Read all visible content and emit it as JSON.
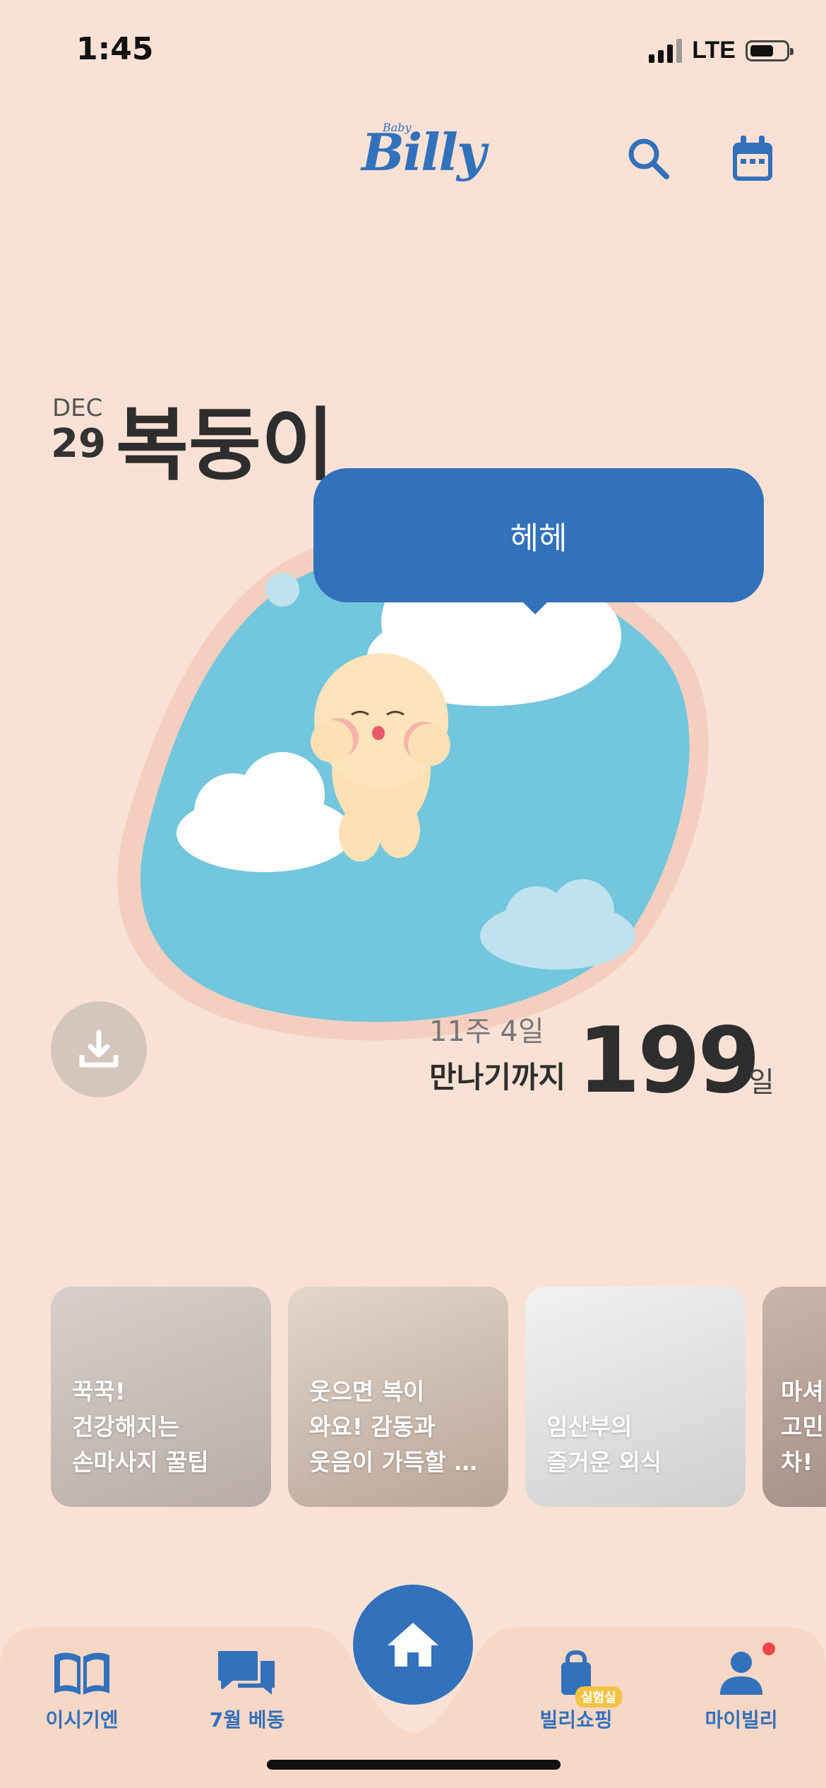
{
  "status_bar": {
    "time": "1:45",
    "network": "LTE"
  },
  "header": {
    "logo_small": "Baby",
    "logo_text": "Billy",
    "search_icon": "search-icon",
    "calendar_icon": "calendar-icon"
  },
  "profile": {
    "month": "DEC",
    "day": "29",
    "name": "복둥이"
  },
  "speech_bubble": {
    "text": "헤헤"
  },
  "countdown": {
    "weeks_days": "11주 4일",
    "until_label": "만나기까지",
    "days": "199",
    "unit": "일"
  },
  "cards": [
    {
      "text": "꾹꾹!\n건강해지는\n손마사지 꿀팁"
    },
    {
      "text": "웃으면 복이\n와요! 감동과\n웃음이 가득할 …"
    },
    {
      "text": "임산부의\n즐거운 외식"
    },
    {
      "text": "마셔\n고민\n차!"
    }
  ],
  "tabbar": {
    "items": [
      {
        "label": "이시기엔",
        "icon": "book-icon"
      },
      {
        "label": "7월 베동",
        "icon": "chat-icon"
      },
      {
        "label": "",
        "icon": "home-icon"
      },
      {
        "label": "빌리쇼핑",
        "icon": "shopping-bag-icon",
        "badge": "실험실"
      },
      {
        "label": "마이빌리",
        "icon": "person-icon"
      }
    ]
  },
  "colors": {
    "accent": "#3271bb",
    "background": "#f9e2d5",
    "sky": "#72c6dd",
    "notification": "#ef4646",
    "badge": "#f5c343"
  }
}
